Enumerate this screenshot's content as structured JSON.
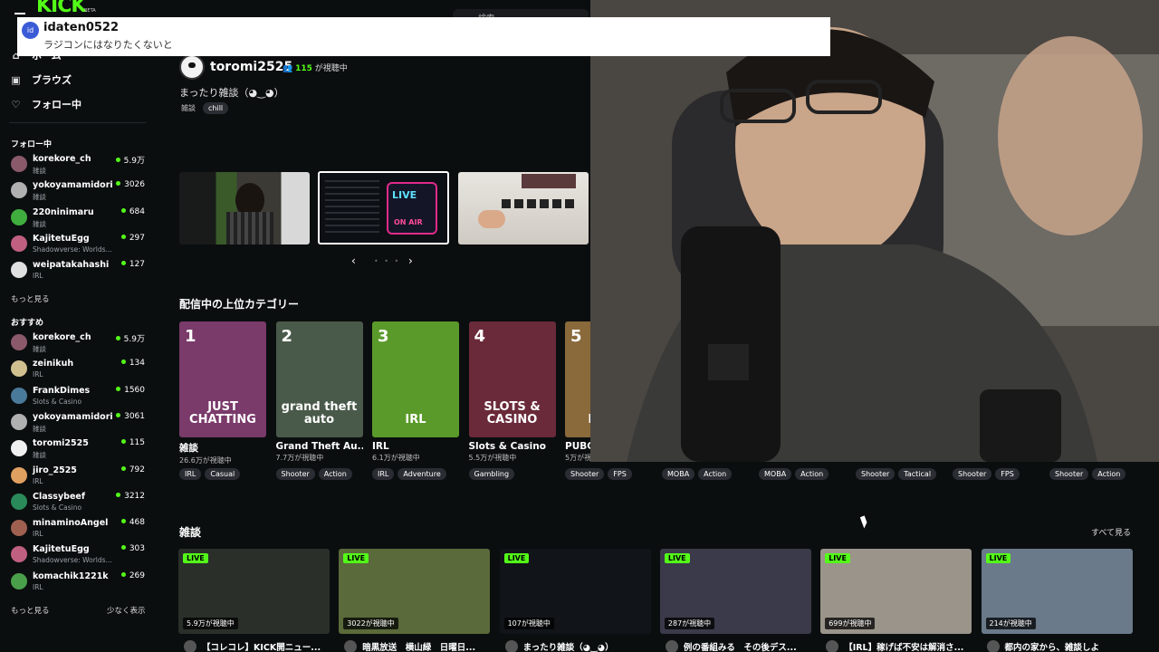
{
  "header": {
    "logo": "KICK",
    "beta": "BETA",
    "search_placeholder": "検索"
  },
  "toast": {
    "avatar": "id",
    "username": "idaten0522",
    "message": "ラジコンにはなりたくないと"
  },
  "sidebar": {
    "nav": [
      {
        "label": "ホーム",
        "icon": "home-icon"
      },
      {
        "label": "ブラウズ",
        "icon": "browse-icon"
      },
      {
        "label": "フォロー中",
        "icon": "heart-icon"
      }
    ],
    "following_title": "フォロー中",
    "following": [
      {
        "name": "korekore_ch",
        "category": "雑談",
        "viewers": "5.9万",
        "color": "#8a5a6a"
      },
      {
        "name": "yokoyamamidori",
        "category": "雑談",
        "viewers": "3026",
        "color": "#b0b0b0"
      },
      {
        "name": "220ninimaru",
        "category": "雑談",
        "viewers": "684",
        "color": "#3fae3f"
      },
      {
        "name": "KajitetuEgg",
        "category": "Shadowverse: Worlds...",
        "viewers": "297",
        "color": "#c06080"
      },
      {
        "name": "weipatakahashi",
        "category": "IRL",
        "viewers": "127",
        "color": "#e0e0e0"
      }
    ],
    "show_more": "もっと見る",
    "recommended_title": "おすすめ",
    "recommended": [
      {
        "name": "korekore_ch",
        "category": "雑談",
        "viewers": "5.9万",
        "color": "#8a5a6a"
      },
      {
        "name": "zeinikuh",
        "category": "IRL",
        "viewers": "134",
        "color": "#d0c090"
      },
      {
        "name": "FrankDimes",
        "category": "Slots & Casino",
        "viewers": "1560",
        "color": "#4a7a9a"
      },
      {
        "name": "yokoyamamidori",
        "category": "雑談",
        "viewers": "3061",
        "color": "#b0b0b0"
      },
      {
        "name": "toromi2525",
        "category": "雑談",
        "viewers": "115",
        "color": "#f0f0f0"
      },
      {
        "name": "jiro_2525",
        "category": "IRL",
        "viewers": "792",
        "color": "#e0a060"
      },
      {
        "name": "Classybeef",
        "category": "Slots & Casino",
        "viewers": "3212",
        "color": "#2a8a5a"
      },
      {
        "name": "minaminoAngel",
        "category": "IRL",
        "viewers": "468",
        "color": "#a06050"
      },
      {
        "name": "KajitetuEgg",
        "category": "Shadowverse: Worlds...",
        "viewers": "303",
        "color": "#c06080"
      },
      {
        "name": "komachik1221k",
        "category": "IRL",
        "viewers": "269",
        "color": "#4aa04a"
      }
    ],
    "show_more2": "もっと見る",
    "show_less": "少なく表示"
  },
  "featured": {
    "streamer": "toromi2525",
    "viewers": "115",
    "viewers_suffix": "が視聴中",
    "title": "まったり雑談（◕‿◕）",
    "tag_category": "雑談",
    "tag": "chill"
  },
  "top_categories": {
    "title": "配信中の上位カテゴリー",
    "items": [
      {
        "rank": "1",
        "art": "JUST CHATTING",
        "name": "雑談",
        "viewers": "26.6万が視聴中",
        "tags": [
          "IRL",
          "Casual"
        ],
        "color": "#7a3a6a"
      },
      {
        "rank": "2",
        "art": "grand theft auto",
        "name": "Grand Theft Au...",
        "viewers": "7.7万が視聴中",
        "tags": [
          "Shooter",
          "Action"
        ],
        "color": "#4a5a4a"
      },
      {
        "rank": "3",
        "art": "IRL",
        "name": "IRL",
        "viewers": "6.1万が視聴中",
        "tags": [
          "IRL",
          "Adventure"
        ],
        "color": "#5a9a2a"
      },
      {
        "rank": "4",
        "art": "SLOTS & CASINO",
        "name": "Slots & Casino",
        "viewers": "5.5万が視聴中",
        "tags": [
          "Gambling"
        ],
        "color": "#6a2a3a"
      },
      {
        "rank": "5",
        "art": "BATTL",
        "name": "PUBG",
        "viewers": "5万が視",
        "tags": [
          "Shooter",
          "FPS"
        ],
        "color": "#8a6a3a"
      }
    ],
    "extra_tags": [
      [
        "MOBA",
        "Action"
      ],
      [
        "MOBA",
        "Action"
      ],
      [
        "Shooter",
        "Tactical"
      ],
      [
        "Shooter",
        "FPS"
      ],
      [
        "Shooter",
        "Action"
      ]
    ]
  },
  "zatsudan": {
    "title": "雑談",
    "see_all": "すべて見る",
    "live_label": "LIVE",
    "videos": [
      {
        "views": "5.9万が視聴中",
        "title": "【コレコレ】KICK開ニュー...",
        "color": "#2a2f2a"
      },
      {
        "views": "3022が視聴中",
        "title": "暗黒放送　横山緑　日曜日...",
        "color": "#5a6a3a"
      },
      {
        "views": "107が視聴中",
        "title": "まったり雑談（◕‿◕）",
        "color": "#111418"
      },
      {
        "views": "287が視聴中",
        "title": "例の番組みる　その後デス...",
        "color": "#3a3a4a"
      },
      {
        "views": "699が視聴中",
        "title": "【IRL】稼げば不安は解消さ...",
        "color": "#9a948a"
      },
      {
        "views": "214が視聴中",
        "title": "都内の家から、雑談しよ",
        "color": "#6a7a8a"
      }
    ]
  },
  "carousel": {
    "prev": "‹",
    "next": "›",
    "dots": "• • •"
  }
}
